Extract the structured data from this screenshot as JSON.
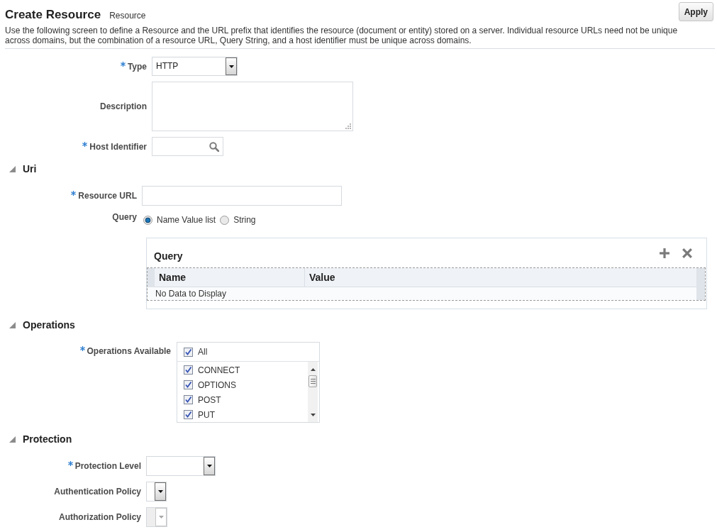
{
  "header": {
    "title": "Create Resource",
    "subtitle": "Resource",
    "apply_button": "Apply",
    "description": "Use the following screen to define a Resource and the URL prefix that identifies the resource (document or entity) stored on a server. Individual resource URLs need not be unique across domains, but the combination of a resource URL, Query String, and a host identifier must be unique across domains."
  },
  "sections": [
    {
      "fields": [
        {
          "kind": "select",
          "label": "Type",
          "required": true,
          "disabled": false,
          "value": "HTTP"
        },
        {
          "kind": "textarea",
          "label": "Description",
          "required": false,
          "disabled": false
        },
        {
          "kind": "search",
          "label": "Host Identifier",
          "required": true,
          "disabled": false
        }
      ]
    },
    {
      "title": "Uri",
      "expanded": true,
      "fields": [
        {
          "kind": "text",
          "label": "Resource URL",
          "required": true,
          "disabled": false
        },
        {
          "kind": "radio",
          "label": "Query",
          "required": false,
          "disabled": false,
          "options": [
            {
              "label": "Name Value list",
              "selected": true
            },
            {
              "label": "String",
              "selected": false
            }
          ]
        }
      ],
      "query_table": {
        "title": "Query",
        "columns": [
          "Name",
          "Value"
        ],
        "empty_text": "No Data to Display"
      }
    },
    {
      "title": "Operations",
      "expanded": true,
      "fields": [
        {
          "kind": "checklist",
          "label": "Operations Available",
          "required": true,
          "disabled": false,
          "all_option": {
            "label": "All",
            "checked": true
          },
          "options": [
            {
              "label": "CONNECT",
              "checked": true
            },
            {
              "label": "OPTIONS",
              "checked": true
            },
            {
              "label": "POST",
              "checked": true
            },
            {
              "label": "PUT",
              "checked": true
            }
          ]
        }
      ]
    },
    {
      "title": "Protection",
      "expanded": true,
      "fields": [
        {
          "kind": "select",
          "label": "Protection Level",
          "required": true,
          "disabled": false
        },
        {
          "kind": "select",
          "label": "Authentication Policy",
          "required": false,
          "disabled": false
        },
        {
          "kind": "select",
          "label": "Authorization Policy",
          "required": false,
          "disabled": true
        }
      ]
    }
  ]
}
